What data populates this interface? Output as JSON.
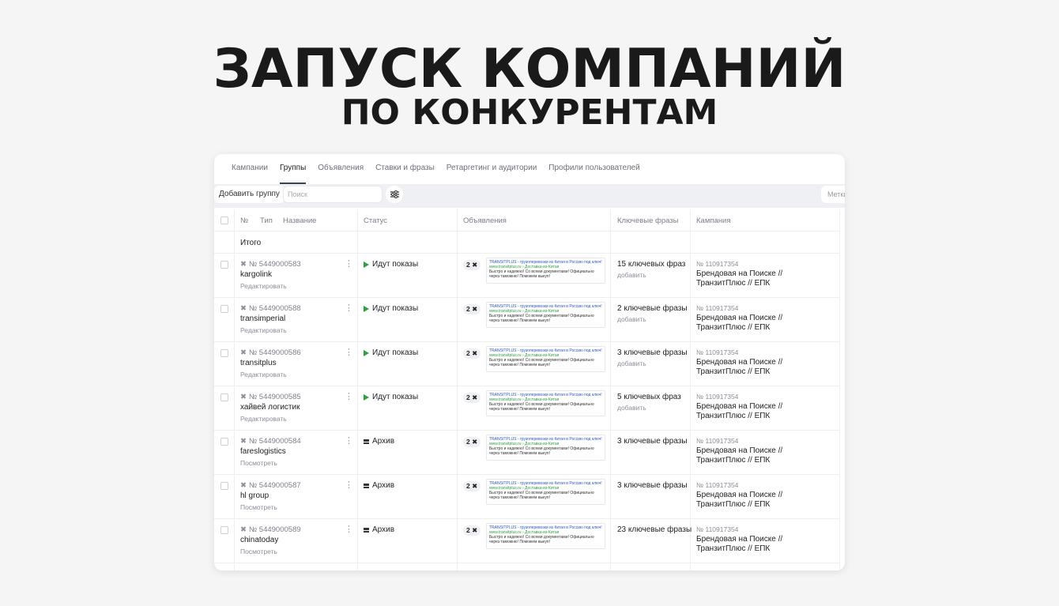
{
  "hero": {
    "title": "ЗАПУСК КОМПАНИЙ",
    "subtitle": "ПО КОНКУРЕНТАМ"
  },
  "tabs": [
    {
      "label": "Кампании",
      "active": false
    },
    {
      "label": "Группы",
      "active": true
    },
    {
      "label": "Объявления",
      "active": false
    },
    {
      "label": "Ставки и фразы",
      "active": false
    },
    {
      "label": "Ретаргетинг и аудитории",
      "active": false
    },
    {
      "label": "Профили пользователей",
      "active": false
    }
  ],
  "toolbar": {
    "add_group": "Добавить группу",
    "search_placeholder": "Поиск",
    "labels": "Метки"
  },
  "table": {
    "headers": {
      "num": "№",
      "type": "Тип",
      "name": "Название",
      "status": "Статус",
      "ads": "Объявления",
      "keywords": "Ключевые фразы",
      "campaign": "Кампания"
    },
    "total_label": "Итого",
    "ad_preview": {
      "title": "TRANSITPLUS - грузоперевозки из Китая в Россию под ключ!",
      "url": "www.transitplus.ru › Доставка-из-Китая",
      "text1": "Быстро и надежно! Со всеми документами! Официально",
      "text2": "через таможню! Поможем выкуп!"
    },
    "rows": [
      {
        "id": "№ 5449000583",
        "name": "kargolink",
        "action": "Редактировать",
        "status": "Идут показы",
        "status_type": "active",
        "ads": "2",
        "keywords": "15 ключевых фраз",
        "kw_add": "добавить",
        "camp_id": "№ 110917354",
        "camp_name": "Брендовая на Поиске // ТранзитПлюс // ЕПК"
      },
      {
        "id": "№ 5449000588",
        "name": "transimperial",
        "action": "Редактировать",
        "status": "Идут показы",
        "status_type": "active",
        "ads": "2",
        "keywords": "2 ключевые фразы",
        "kw_add": "добавить",
        "camp_id": "№ 110917354",
        "camp_name": "Брендовая на Поиске // ТранзитПлюс // ЕПК"
      },
      {
        "id": "№ 5449000586",
        "name": "transitplus",
        "action": "Редактировать",
        "status": "Идут показы",
        "status_type": "active",
        "ads": "2",
        "keywords": "3 ключевые фразы",
        "kw_add": "добавить",
        "camp_id": "№ 110917354",
        "camp_name": "Брендовая на Поиске // ТранзитПлюс // ЕПК"
      },
      {
        "id": "№ 5449000585",
        "name": "хайвей логистик",
        "action": "Редактировать",
        "status": "Идут показы",
        "status_type": "active",
        "ads": "2",
        "keywords": "5 ключевых фраз",
        "kw_add": "добавить",
        "camp_id": "№ 110917354",
        "camp_name": "Брендовая на Поиске // ТранзитПлюс // ЕПК"
      },
      {
        "id": "№ 5449000584",
        "name": "fareslogistics",
        "action": "Посмотреть",
        "status": "Архив",
        "status_type": "archive",
        "ads": "2",
        "keywords": "3 ключевые фразы",
        "kw_add": "",
        "camp_id": "№ 110917354",
        "camp_name": "Брендовая на Поиске // ТранзитПлюс // ЕПК"
      },
      {
        "id": "№ 5449000587",
        "name": "hl group",
        "action": "Посмотреть",
        "status": "Архив",
        "status_type": "archive",
        "ads": "2",
        "keywords": "3 ключевые фразы",
        "kw_add": "",
        "camp_id": "№ 110917354",
        "camp_name": "Брендовая на Поиске // ТранзитПлюс // ЕПК"
      },
      {
        "id": "№ 5449000589",
        "name": "chinatoday",
        "action": "Посмотреть",
        "status": "Архив",
        "status_type": "archive",
        "ads": "2",
        "keywords": "23 ключевые фразы",
        "kw_add": "",
        "camp_id": "№ 110917354",
        "camp_name": "Брендовая на Поиске // ТранзитПлюс // ЕПК"
      }
    ]
  },
  "colors": {
    "active_status": "#2f9e44",
    "ad_title": "#2b59c3",
    "ad_url": "#2f9e44"
  }
}
